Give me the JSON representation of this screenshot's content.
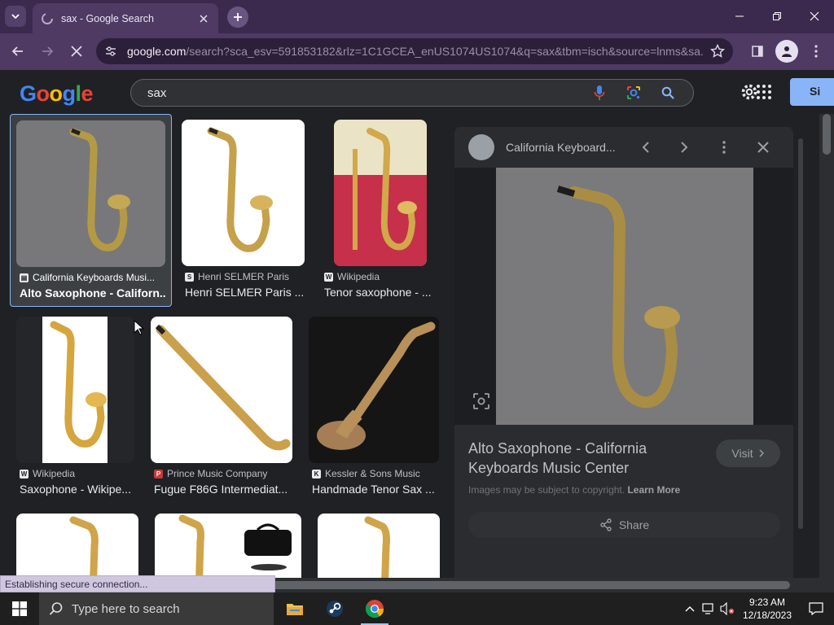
{
  "browser": {
    "tab_title": "sax - Google Search",
    "url_host": "google.com",
    "url_rest": "/search?sca_esv=591853182&rlz=1C1GCEA_enUS1074US1074&q=sax&tbm=isch&source=lnms&sa..."
  },
  "google": {
    "logo_letters": [
      "G",
      "o",
      "o",
      "g",
      "l",
      "e"
    ],
    "logo_colors": [
      "#4285f4",
      "#ea4335",
      "#fbbc05",
      "#4285f4",
      "#34a853",
      "#ea4335"
    ],
    "query": "sax",
    "signin_label": "Si"
  },
  "results": [
    {
      "source": "California Keyboards Musi...",
      "source_icon": "page-icon",
      "title": "Alto Saxophone - Californ...",
      "selected": true
    },
    {
      "source": "Henri SELMER Paris",
      "source_icon": "selmer-logo-icon",
      "title": "Henri SELMER Paris ..."
    },
    {
      "source": "Wikipedia",
      "source_icon": "wikipedia-icon",
      "title": "Tenor saxophone - ..."
    },
    {
      "source": "Wikipedia",
      "source_icon": "wikipedia-icon",
      "title": "Saxophone - Wikipe..."
    },
    {
      "source": "Prince Music Company",
      "source_icon": "prince-logo-icon",
      "title": "Fugue F86G Intermediat..."
    },
    {
      "source": "Kessler & Sons Music",
      "source_icon": "kessler-logo-icon",
      "title": "Handmade Tenor Sax ..."
    }
  ],
  "panel": {
    "site_name": "California Keyboard...",
    "title": "Alto Saxophone - California Keyboards Music Center",
    "visit_label": "Visit",
    "copyright_text": "Images may be subject to copyright.",
    "learn_more": "Learn More",
    "share_label": "Share"
  },
  "status_text": "Establishing secure connection...",
  "taskbar": {
    "search_placeholder": "Type here to search",
    "time": "9:23 AM",
    "date": "12/18/2023",
    "apps": [
      "file-explorer-icon",
      "steam-icon",
      "chrome-icon"
    ]
  }
}
